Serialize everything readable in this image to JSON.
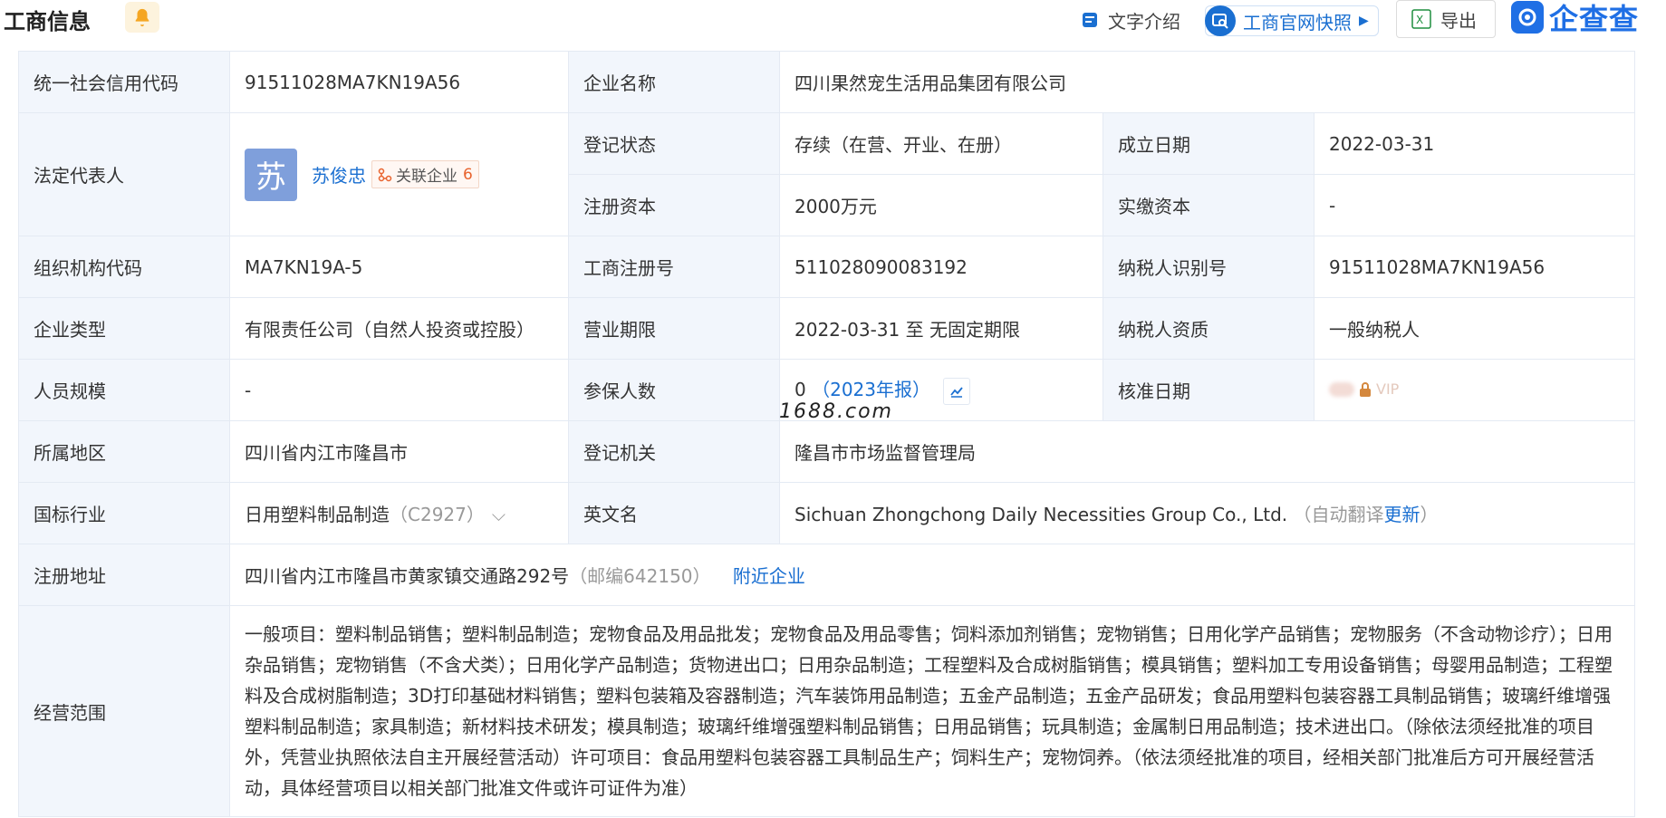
{
  "header": {
    "title": "工商信息",
    "text_intro": "文字介绍",
    "snapshot": "工商官网快照",
    "export": "导出",
    "logo": "企查查"
  },
  "rows": {
    "credit_code_label": "统一社会信用代码",
    "credit_code": "91511028MA7KN19A56",
    "company_name_label": "企业名称",
    "company_name": "四川果然宠生活用品集团有限公司",
    "legal_rep_label": "法定代表人",
    "legal_rep_avatar": "苏",
    "legal_rep_name": "苏俊忠",
    "related_label": "关联企业",
    "related_count": "6",
    "reg_status_label": "登记状态",
    "reg_status": "存续（在营、开业、在册）",
    "founded_label": "成立日期",
    "founded": "2022-03-31",
    "reg_capital_label": "注册资本",
    "reg_capital": "2000万元",
    "paid_capital_label": "实缴资本",
    "paid_capital": "-",
    "org_code_label": "组织机构代码",
    "org_code": "MA7KN19A-5",
    "biz_reg_no_label": "工商注册号",
    "biz_reg_no": "511028090083192",
    "taxpayer_id_label": "纳税人识别号",
    "taxpayer_id": "91511028MA7KN19A56",
    "type_label": "企业类型",
    "type": "有限责任公司（自然人投资或控股）",
    "term_label": "营业期限",
    "term": "2022-03-31 至 无固定期限",
    "tax_qual_label": "纳税人资质",
    "tax_qual": "一般纳税人",
    "staff_label": "人员规模",
    "staff": "-",
    "insured_label": "参保人数",
    "insured": "0",
    "insured_year": "（2023年报）",
    "approved_label": "核准日期",
    "approved_vip": "VIP",
    "region_label": "所属地区",
    "region": "四川省内江市隆昌市",
    "authority_label": "登记机关",
    "authority": "隆昌市市场监督管理局",
    "industry_label": "国标行业",
    "industry": "日用塑料制品制造",
    "industry_code": "（C2927）",
    "english_label": "英文名",
    "english": "Sichuan Zhongchong Daily Necessities Group Co., Ltd.",
    "english_note_open": "（自动翻译",
    "english_update": "更新",
    "english_note_close": "）",
    "address_label": "注册地址",
    "address": "四川省内江市隆昌市黄家镇交通路292号",
    "postcode": "（邮编642150）",
    "nearby": "附近企业",
    "scope_label": "经营范围",
    "scope": "一般项目：塑料制品销售；塑料制品制造；宠物食品及用品批发；宠物食品及用品零售；饲料添加剂销售；宠物销售；日用化学产品销售；宠物服务（不含动物诊疗）；日用杂品销售；宠物销售（不含犬类）；日用化学产品制造；货物进出口；日用杂品制造；工程塑料及合成树脂销售；模具销售；塑料加工专用设备销售；母婴用品制造；工程塑料及合成树脂制造；3D打印基础材料销售；塑料包装箱及容器制造；汽车装饰用品制造；五金产品制造；五金产品研发；食品用塑料包装容器工具制品销售；玻璃纤维增强塑料制品制造；家具制造；新材料技术研发；模具制造；玻璃纤维增强塑料制品销售；日用品销售；玩具制造；金属制日用品制造；技术进出口。（除依法须经批准的项目外，凭营业执照依法自主开展经营活动）许可项目：食品用塑料包装容器工具制品生产；饲料生产；宠物饲养。（依法须经批准的项目，经相关部门批准后方可开展经营活动，具体经营项目以相关部门批准文件或许可证件为准）"
  },
  "watermark": "1688.com",
  "colors": {
    "link": "#1a6fd1",
    "label_bg": "#f2f6fc",
    "border": "#e4eaf3",
    "accent_orange": "#e8632e"
  }
}
